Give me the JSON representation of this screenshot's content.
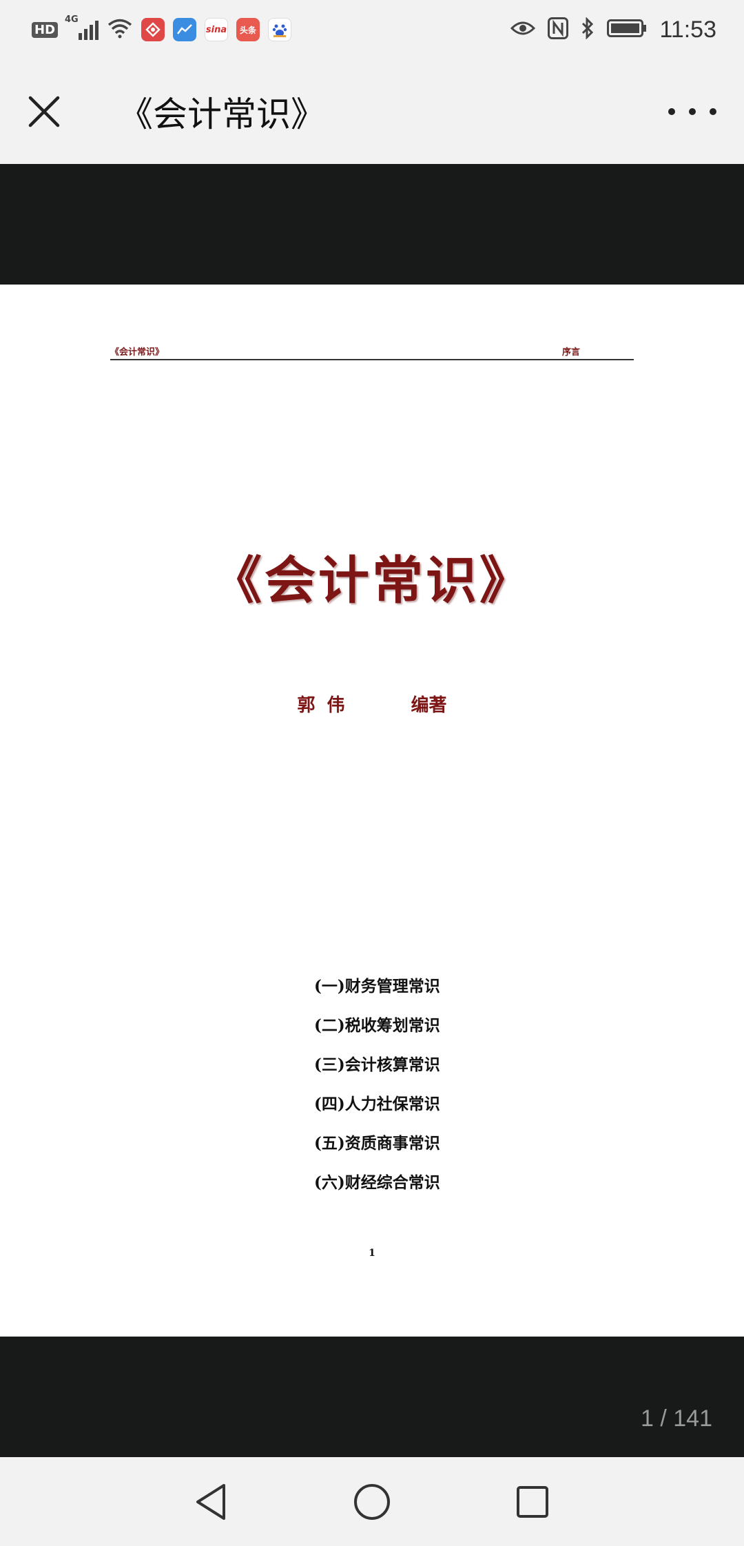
{
  "status_bar": {
    "hd_label": "HD",
    "network_label": "4G",
    "time": "11:53",
    "icons": [
      "signal-icon",
      "wifi-icon",
      "app-icon-red",
      "app-icon-blue",
      "sina-icon",
      "toutiao-icon",
      "baidu-icon",
      "eye-icon",
      "nfc-icon",
      "bluetooth-icon",
      "battery-icon"
    ],
    "app_sina_label": "sina",
    "app_toutiao_label": "头条"
  },
  "title_bar": {
    "title": "《会计常识》"
  },
  "document": {
    "header_left": "《会计常识》",
    "header_right": "序言",
    "title": "《会计常识》",
    "author_name": "郭 伟",
    "author_role": "编著",
    "toc": [
      "(一)财务管理常识",
      "(二)税收筹划常识",
      "(三)会计核算常识",
      "(四)人力社保常识",
      "(五)资质商事常识",
      "(六)财经综合常识"
    ],
    "page_number": "1"
  },
  "viewer": {
    "page_counter": "1 / 141"
  },
  "colors": {
    "title_red": "#7d1515",
    "dark_band": "#171a18",
    "chrome_bg": "#f2f2f2"
  }
}
